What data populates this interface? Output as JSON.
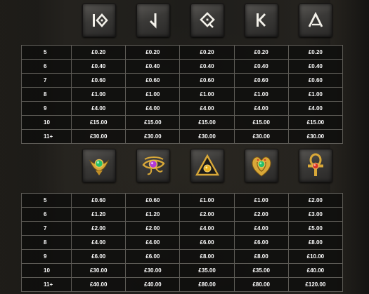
{
  "currency": "£",
  "low_symbols": {
    "icons": [
      "ten-symbol-icon",
      "j-symbol-icon",
      "q-symbol-icon",
      "k-symbol-icon",
      "a-symbol-icon"
    ],
    "rows": [
      {
        "count": "5",
        "payouts": [
          "£0.20",
          "£0.20",
          "£0.20",
          "£0.20",
          "£0.20"
        ]
      },
      {
        "count": "6",
        "payouts": [
          "£0.40",
          "£0.40",
          "£0.40",
          "£0.40",
          "£0.40"
        ]
      },
      {
        "count": "7",
        "payouts": [
          "£0.60",
          "£0.60",
          "£0.60",
          "£0.60",
          "£0.60"
        ]
      },
      {
        "count": "8",
        "payouts": [
          "£1.00",
          "£1.00",
          "£1.00",
          "£1.00",
          "£1.00"
        ]
      },
      {
        "count": "9",
        "payouts": [
          "£4.00",
          "£4.00",
          "£4.00",
          "£4.00",
          "£4.00"
        ]
      },
      {
        "count": "10",
        "payouts": [
          "£15.00",
          "£15.00",
          "£15.00",
          "£15.00",
          "£15.00"
        ]
      },
      {
        "count": "11+",
        "payouts": [
          "£30.00",
          "£30.00",
          "£30.00",
          "£30.00",
          "£30.00"
        ]
      }
    ]
  },
  "high_symbols": {
    "icons": [
      "scarab-amulet-icon",
      "eye-of-horus-icon",
      "pyramid-eye-icon",
      "cobra-amulet-icon",
      "ankh-icon"
    ],
    "rows": [
      {
        "count": "5",
        "payouts": [
          "£0.60",
          "£0.60",
          "£1.00",
          "£1.00",
          "£2.00"
        ]
      },
      {
        "count": "6",
        "payouts": [
          "£1.20",
          "£1.20",
          "£2.00",
          "£2.00",
          "£3.00"
        ]
      },
      {
        "count": "7",
        "payouts": [
          "£2.00",
          "£2.00",
          "£4.00",
          "£4.00",
          "£5.00"
        ]
      },
      {
        "count": "8",
        "payouts": [
          "£4.00",
          "£4.00",
          "£6.00",
          "£6.00",
          "£8.00"
        ]
      },
      {
        "count": "9",
        "payouts": [
          "£6.00",
          "£6.00",
          "£8.00",
          "£8.00",
          "£10.00"
        ]
      },
      {
        "count": "10",
        "payouts": [
          "£30.00",
          "£30.00",
          "£35.00",
          "£35.00",
          "£40.00"
        ]
      },
      {
        "count": "11+",
        "payouts": [
          "£40.00",
          "£40.00",
          "£80.00",
          "£80.00",
          "£120.00"
        ]
      }
    ]
  },
  "colors": {
    "gold": "#d9a838",
    "gem_green": "#27c06a",
    "gem_purple": "#b238d8",
    "gem_amber": "#e9b020",
    "gem_red": "#d8352a",
    "stone": "#3a3937",
    "table_border": "#5d5b56"
  }
}
